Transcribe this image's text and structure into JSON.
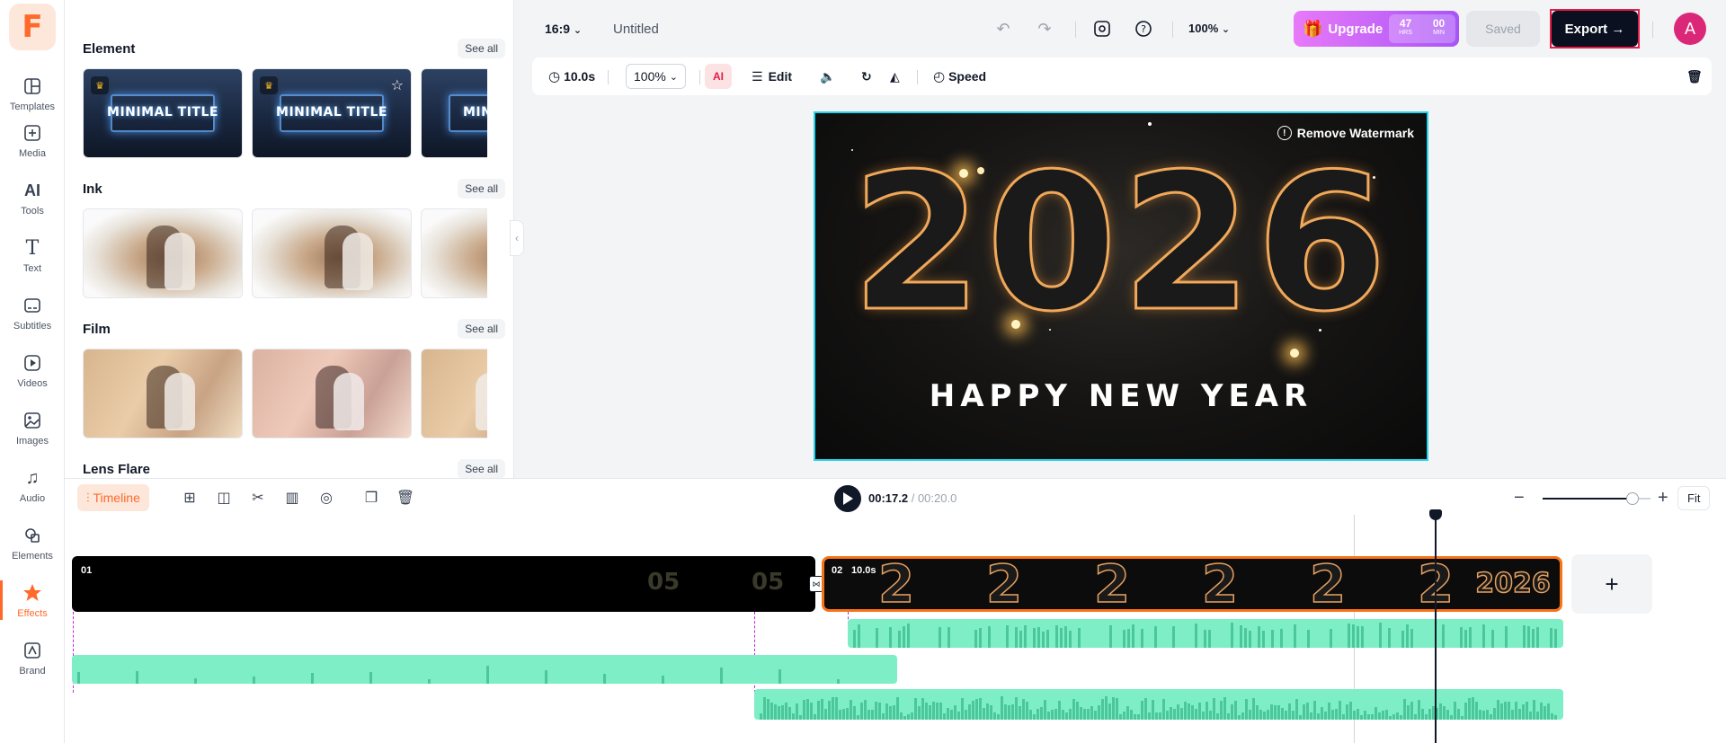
{
  "app": {
    "logo": "F"
  },
  "rail": [
    {
      "label": "Templates",
      "icon": "templates-icon"
    },
    {
      "label": "Media",
      "icon": "media-icon"
    },
    {
      "label": "Tools",
      "icon": "ai-tools-icon"
    },
    {
      "label": "Text",
      "icon": "text-icon"
    },
    {
      "label": "Subtitles",
      "icon": "subtitles-icon"
    },
    {
      "label": "Videos",
      "icon": "videos-icon"
    },
    {
      "label": "Images",
      "icon": "images-icon"
    },
    {
      "label": "Audio",
      "icon": "audio-icon"
    },
    {
      "label": "Elements",
      "icon": "elements-icon"
    },
    {
      "label": "Effects",
      "icon": "effects-icon",
      "active": true
    },
    {
      "label": "Brand",
      "icon": "brand-icon"
    }
  ],
  "panel": {
    "see_all": "See all",
    "sections": [
      {
        "title": "Element",
        "thumbs": [
          "MINIMAL TITLE",
          "MINIMAL TITLE",
          "MINI"
        ]
      },
      {
        "title": "Ink"
      },
      {
        "title": "Film"
      },
      {
        "title": "Lens Flare"
      }
    ]
  },
  "topbar": {
    "ratio": "16:9",
    "title": "Untitled",
    "zoom": "100%",
    "upgrade": "Upgrade",
    "countdown": {
      "hours": "47",
      "hours_unit": "HRS",
      "mins": "00",
      "mins_unit": "MIN"
    },
    "saved": "Saved",
    "export": "Export",
    "avatar": "A"
  },
  "cliptools": {
    "duration": "10.0s",
    "scale": "100%",
    "ai": "AI",
    "edit": "Edit",
    "speed": "Speed"
  },
  "canvas": {
    "watermark": "Remove Watermark",
    "year": "2026",
    "greeting": "HAPPY NEW YEAR"
  },
  "timeline": {
    "tab": "Timeline",
    "current": "00:17.2",
    "separator": " / ",
    "total": "00:20.0",
    "fit": "Fit",
    "clip1": {
      "label": "01",
      "frame_text": "05"
    },
    "clip2": {
      "label": "02",
      "duration": "10.0s",
      "frame_text": "2"
    },
    "add": "+"
  },
  "colors": {
    "accent": "#ff6a2b",
    "export_border": "#e11d48",
    "clip_border": "#f97316",
    "audio": "#7eeec6",
    "canvas_border": "#22d3ee"
  }
}
